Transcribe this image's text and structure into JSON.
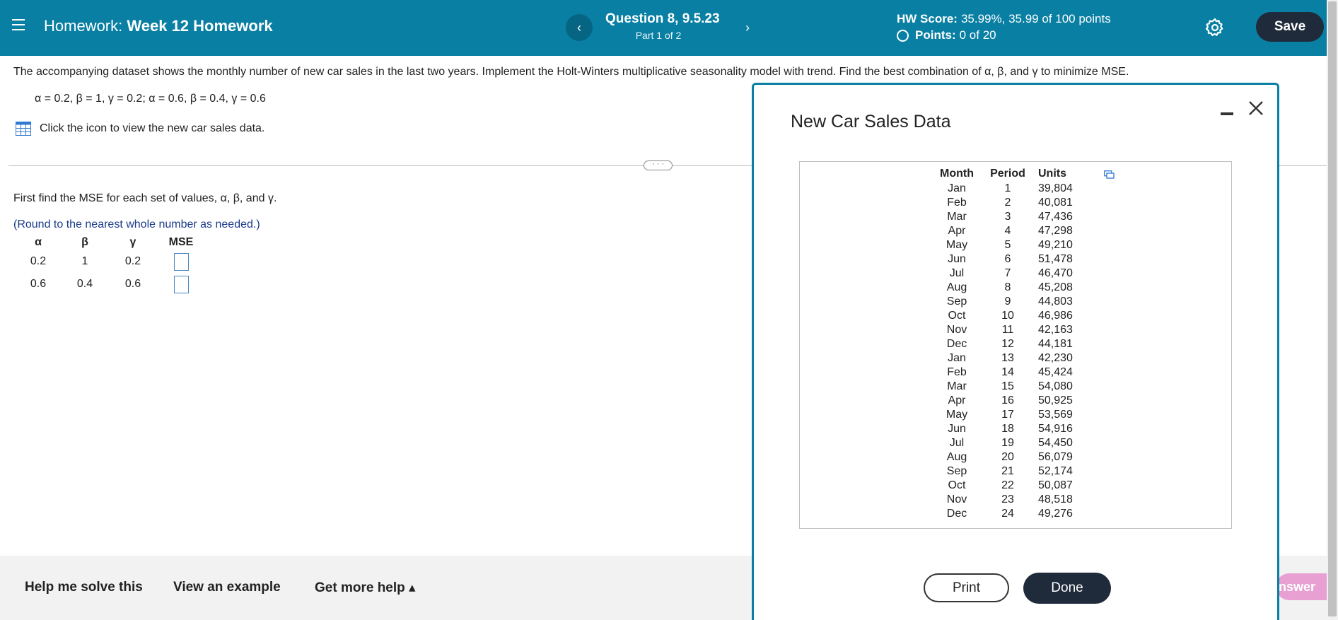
{
  "header": {
    "title_prefix": "Homework:",
    "title_name": "Week 12 Homework",
    "prev_arrow": "‹",
    "next_arrow": "›",
    "question_title": "Question 8, 9.5.23",
    "question_part": "Part 1 of 2",
    "hw_score_label": "HW Score:",
    "hw_score_value": "35.99%, 35.99 of 100 points",
    "points_label": "Points:",
    "points_value": "0 of 20",
    "save_label": "Save",
    "icons": {
      "menu": "hamburger-menu-icon",
      "settings": "gear-icon"
    }
  },
  "question": {
    "prompt": "The accompanying dataset shows the monthly number of new car sales in the last two years. Implement the Holt-Winters multiplicative seasonality model with trend. Find the best combination of α, β, and γ to minimize MSE.",
    "params": "α = 0.2, β = 1, γ = 0.2; α = 0.6, β = 0.4, γ = 0.6",
    "data_link": "Click the icon to view the new car sales data.",
    "ellipsis": "· · ·",
    "instruction": "First find the MSE for each set of values, α, β, and γ.",
    "round_note": "(Round to the nearest whole number as needed.)",
    "table": {
      "headers": [
        "α",
        "β",
        "γ",
        "MSE"
      ],
      "rows": [
        {
          "alpha": "0.2",
          "beta": "1",
          "gamma": "0.2",
          "mse": ""
        },
        {
          "alpha": "0.6",
          "beta": "0.4",
          "gamma": "0.6",
          "mse": ""
        }
      ]
    }
  },
  "bottom": {
    "help_solve": "Help me solve this",
    "view_example": "View an example",
    "more_help": "Get more help ▴",
    "answer_partial": "nswer"
  },
  "modal": {
    "title": "New Car Sales Data",
    "headers": [
      "Month",
      "Period",
      "Units"
    ],
    "rows": [
      [
        "Jan",
        "1",
        "39,804"
      ],
      [
        "Feb",
        "2",
        "40,081"
      ],
      [
        "Mar",
        "3",
        "47,436"
      ],
      [
        "Apr",
        "4",
        "47,298"
      ],
      [
        "May",
        "5",
        "49,210"
      ],
      [
        "Jun",
        "6",
        "51,478"
      ],
      [
        "Jul",
        "7",
        "46,470"
      ],
      [
        "Aug",
        "8",
        "45,208"
      ],
      [
        "Sep",
        "9",
        "44,803"
      ],
      [
        "Oct",
        "10",
        "46,986"
      ],
      [
        "Nov",
        "11",
        "42,163"
      ],
      [
        "Dec",
        "12",
        "44,181"
      ],
      [
        "Jan",
        "13",
        "42,230"
      ],
      [
        "Feb",
        "14",
        "45,424"
      ],
      [
        "Mar",
        "15",
        "54,080"
      ],
      [
        "Apr",
        "16",
        "50,925"
      ],
      [
        "May",
        "17",
        "53,569"
      ],
      [
        "Jun",
        "18",
        "54,916"
      ],
      [
        "Jul",
        "19",
        "54,450"
      ],
      [
        "Aug",
        "20",
        "56,079"
      ],
      [
        "Sep",
        "21",
        "52,174"
      ],
      [
        "Oct",
        "22",
        "50,087"
      ],
      [
        "Nov",
        "23",
        "48,518"
      ],
      [
        "Dec",
        "24",
        "49,276"
      ]
    ],
    "print_label": "Print",
    "done_label": "Done"
  },
  "colors": {
    "header_bg": "#087fa3",
    "dark_button": "#1f2a3a",
    "note_text": "#1a3a8a",
    "answer_button": "#e8a0d2"
  }
}
